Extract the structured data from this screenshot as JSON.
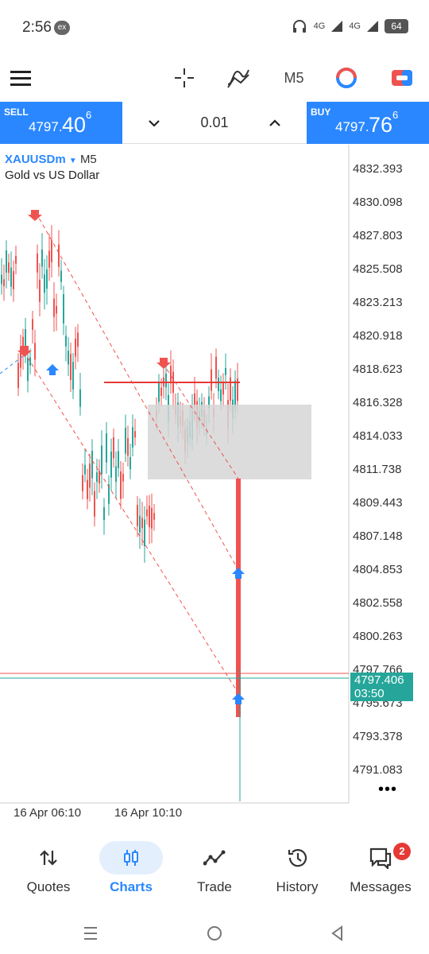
{
  "status": {
    "time": "2:56",
    "ex_badge": "ex",
    "net1": "4G",
    "net2": "4G",
    "battery": "64"
  },
  "toolbar": {
    "menu_icon": "hamburger-icon",
    "crosshair_icon": "crosshair-icon",
    "indicators_icon": "indicators-icon",
    "timeframe": "M5",
    "objects_icon": "objects-icon",
    "trade_icon": "trade-toggle-icon"
  },
  "trade": {
    "sell_label": "SELL",
    "sell_price_small": "4797.",
    "sell_price_big": "40",
    "sell_price_sup": "6",
    "buy_label": "BUY",
    "buy_price_small": "4797.",
    "buy_price_big": "76",
    "buy_price_sup": "6",
    "lot": "0.01"
  },
  "chart": {
    "symbol": "XAUUSDm",
    "timeframe": "M5",
    "description": "Gold vs US Dollar",
    "price_axis": [
      "4832.393",
      "4830.098",
      "4827.803",
      "4825.508",
      "4823.213",
      "4820.918",
      "4818.623",
      "4816.328",
      "4814.033",
      "4811.738",
      "4809.443",
      "4807.148",
      "4804.853",
      "4802.558",
      "4800.263",
      "4797.766",
      "4795.673",
      "4793.378",
      "4791.083"
    ],
    "current_price": "4797.406",
    "countdown": "03:50",
    "time_axis": [
      "16 Apr 06:10",
      "16 Apr 10:10"
    ],
    "bull_color": "#26a69a",
    "bear_color": "#ef5350"
  },
  "nav": {
    "items": [
      {
        "label": "Quotes",
        "icon": "quotes-icon"
      },
      {
        "label": "Charts",
        "icon": "charts-icon"
      },
      {
        "label": "Trade",
        "icon": "trade-icon"
      },
      {
        "label": "History",
        "icon": "history-icon"
      },
      {
        "label": "Messages",
        "icon": "messages-icon"
      }
    ],
    "messages_badge": "2"
  }
}
